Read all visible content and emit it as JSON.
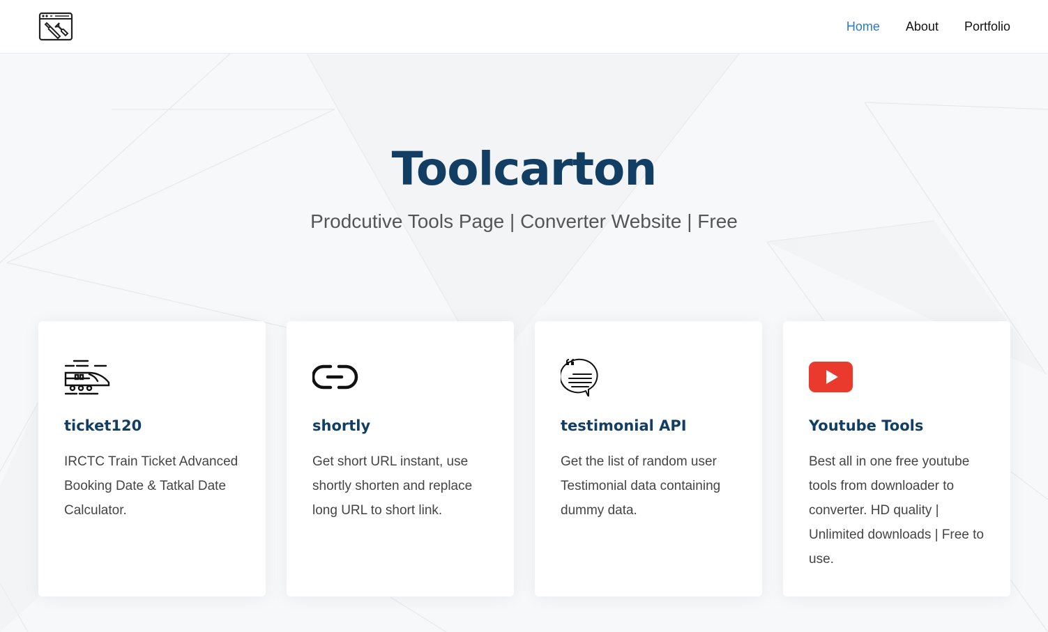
{
  "nav": {
    "items": [
      {
        "label": "Home",
        "active": true
      },
      {
        "label": "About",
        "active": false
      },
      {
        "label": "Portfolio",
        "active": false
      }
    ],
    "active_color": "#2b7bc0"
  },
  "hero": {
    "title": "Toolcarton",
    "subtitle": "Prodcutive Tools Page | Converter Website | Free"
  },
  "cards": [
    {
      "icon": "train-icon",
      "title": "ticket120",
      "description": "IRCTC Train Ticket Advanced Booking Date & Tatkal Date Calculator."
    },
    {
      "icon": "link-icon",
      "title": "shortly",
      "description": "Get short URL instant, use shortly shorten and replace long URL to short link."
    },
    {
      "icon": "quote-chat-icon",
      "title": "testimonial API",
      "description": "Get the list of random user Testimonial data containing dummy data."
    },
    {
      "icon": "youtube-icon",
      "title": "Youtube Tools",
      "description": "Best all in one free youtube tools from downloader to converter. HD quality | Unlimited downloads | Free to use."
    }
  ],
  "colors": {
    "title": "#133e63",
    "youtube_red": "#ea3a2e"
  }
}
